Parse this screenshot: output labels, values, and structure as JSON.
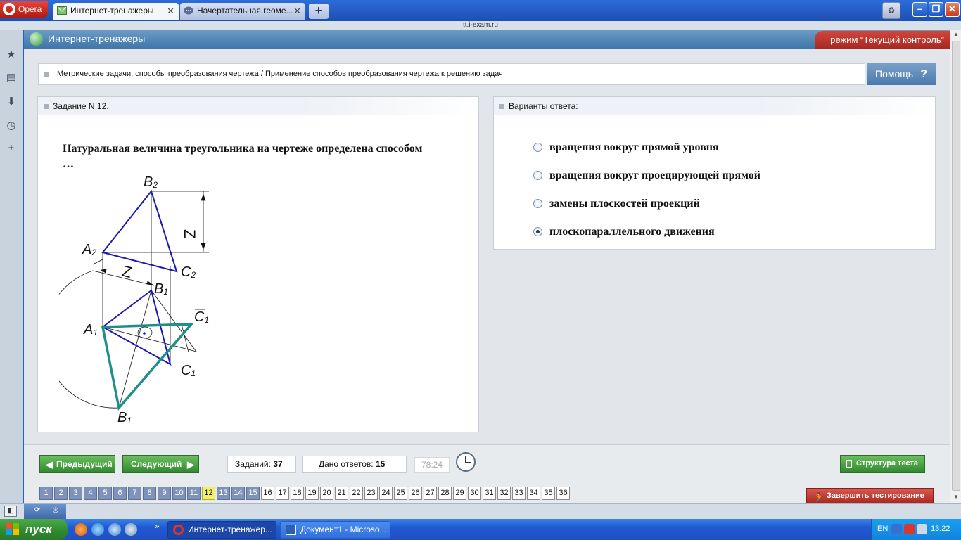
{
  "browser": {
    "opera_label": "Opera",
    "tabs": [
      {
        "label": "Интернет-тренажеры",
        "active": true
      },
      {
        "label": "Начертательная геоме...",
        "active": false
      }
    ],
    "url": "tt.i-exam.ru"
  },
  "app": {
    "title": "Интернет-тренажеры",
    "mode": "режим “Текущий контроль”",
    "topic": "Метрические задачи, способы преобразования чертежа / Применение способов преобразования чертежа к решению задач",
    "help_label": "Помощь",
    "help_glyph": "?"
  },
  "question": {
    "header": "Задание N 12.",
    "text": "Натуральная величина треугольника на чертеже определена способом …",
    "figure_labels": {
      "b2": "B",
      "b2_sub": "2",
      "a2": "A",
      "a2_sub": "2",
      "c2": "C",
      "c2_sub": "2",
      "b1": "B",
      "b1_sub": "1",
      "a1": "A",
      "a1_sub": "1",
      "c1bar": "C",
      "c1bar_sub": "1",
      "c1": "C",
      "c1_sub": "1",
      "b1bar": "B",
      "b1bar_sub": "1",
      "z_vertical": "Z",
      "z_diagonal": "Z"
    }
  },
  "answers": {
    "header": "Варианты ответа:",
    "options": [
      {
        "label": "вращения вокруг прямой уровня",
        "selected": false
      },
      {
        "label": "вращения вокруг проецирующей прямой",
        "selected": false
      },
      {
        "label": "замены плоскостей проекций",
        "selected": false
      },
      {
        "label": "плоскопараллельного движения",
        "selected": true
      }
    ]
  },
  "nav": {
    "prev_label": "Предыдущий",
    "next_label": "Следующий",
    "tasks_label": "Заданий:",
    "tasks_count": "37",
    "answers_label": "Дано ответов:",
    "answers_count": "15",
    "timer": "78:24",
    "structure_label": "Структура теста",
    "finish_label": "Завершить тестирование",
    "numbers": [
      "1",
      "2",
      "3",
      "4",
      "5",
      "6",
      "7",
      "8",
      "9",
      "10",
      "11",
      "12",
      "13",
      "14",
      "15",
      "16",
      "17",
      "18",
      "19",
      "20",
      "21",
      "22",
      "23",
      "24",
      "25",
      "26",
      "27",
      "28",
      "29",
      "30",
      "31",
      "32",
      "33",
      "34",
      "35",
      "36"
    ],
    "current": 12,
    "answered_upto": 15
  },
  "taskbar": {
    "start_label": "пуск",
    "chevron": "»",
    "tasks": [
      {
        "label": "Интернет-тренажер...",
        "active": true
      },
      {
        "label": "Документ1 - Microso...",
        "active": false
      }
    ],
    "lang": "EN",
    "time": "13:22"
  },
  "colors": {
    "figure_blue": "#1a1ab0",
    "figure_teal": "#1f8f8a",
    "mode_red": "#c0392b",
    "current_yellow": "#f3f067",
    "answered_blue": "#7f93ba"
  }
}
